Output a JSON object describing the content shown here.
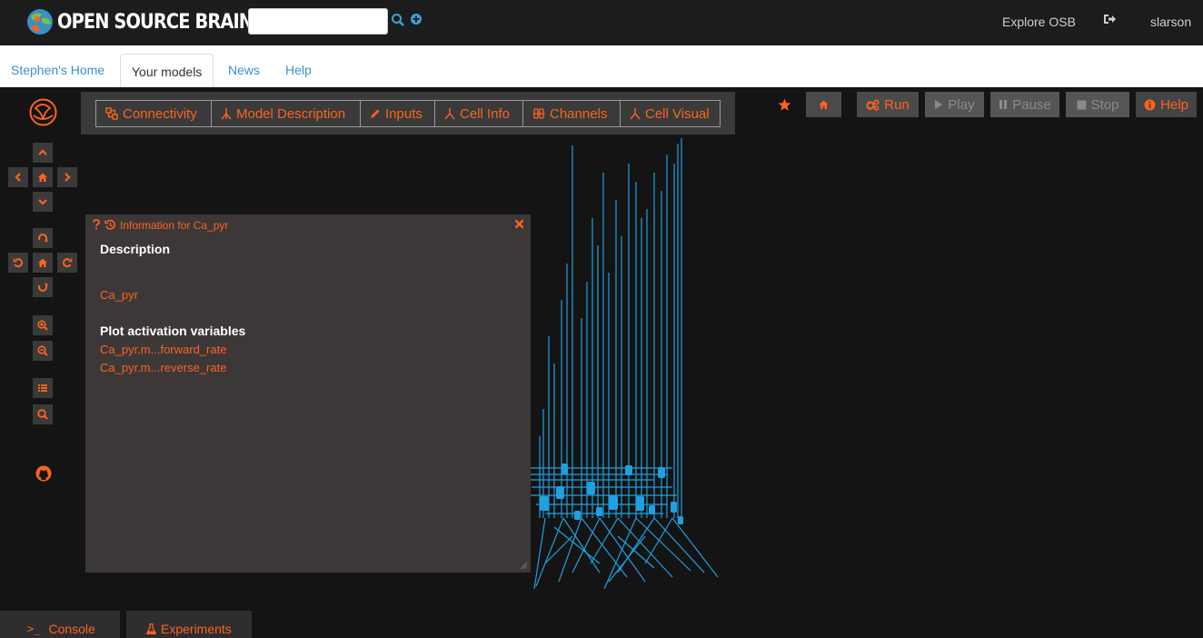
{
  "header": {
    "logo_text": "OPEN SOURCE BRAIN",
    "search": {
      "value": "",
      "placeholder": ""
    },
    "explore_label": "Explore OSB",
    "username": "slarson"
  },
  "nav": {
    "tabs": [
      {
        "label": "Stephen's Home"
      },
      {
        "label": "Your models",
        "active": true
      },
      {
        "label": "News"
      },
      {
        "label": "Help"
      }
    ]
  },
  "toolbar": {
    "buttons": [
      {
        "label": "Connectivity",
        "icon": "connectivity-icon"
      },
      {
        "label": "Model Description",
        "icon": "model-icon"
      },
      {
        "label": "Inputs",
        "icon": "pencil-icon"
      },
      {
        "label": "Cell Info",
        "icon": "cell-icon"
      },
      {
        "label": "Channels",
        "icon": "channels-icon"
      },
      {
        "label": "Cell Visual",
        "icon": "cell-icon"
      }
    ]
  },
  "sim_controls": {
    "run": "Run",
    "play": "Play",
    "pause": "Pause",
    "stop": "Stop",
    "help": "Help"
  },
  "info_window": {
    "title": "Information for Ca_pyr",
    "description_heading": "Description",
    "description_value": "Ca_pyr",
    "plot_heading": "Plot activation variables",
    "plot_links": [
      "Ca_pyr.m...forward_rate",
      "Ca_pyr.m...reverse_rate"
    ]
  },
  "bottom_tabs": {
    "console": "Console",
    "experiments": "Experiments"
  },
  "colors": {
    "accent": "#fc6320",
    "link_blue": "#3b8fd1",
    "neuron_blue": "#1fa0e0",
    "panel_bg": "#3c3838",
    "canvas_bg": "#141414"
  }
}
